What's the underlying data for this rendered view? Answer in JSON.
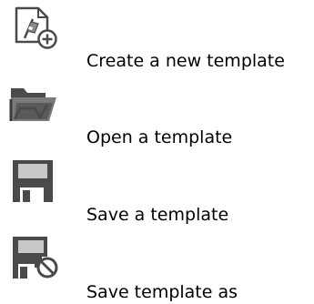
{
  "toolbar_legend": {
    "items": [
      {
        "icon": "new-template-icon",
        "label": "Create a new template"
      },
      {
        "icon": "open-folder-icon",
        "label": "Open a template"
      },
      {
        "icon": "save-disk-icon",
        "label": "Save a template"
      },
      {
        "icon": "save-as-disk-icon",
        "label": "Save template as"
      }
    ]
  },
  "colors": {
    "icon_dark": "#4a4a4a",
    "icon_mid": "#7a7a7a",
    "icon_light": "#c8c8c8",
    "text": "#000000",
    "background": "#ffffff"
  }
}
